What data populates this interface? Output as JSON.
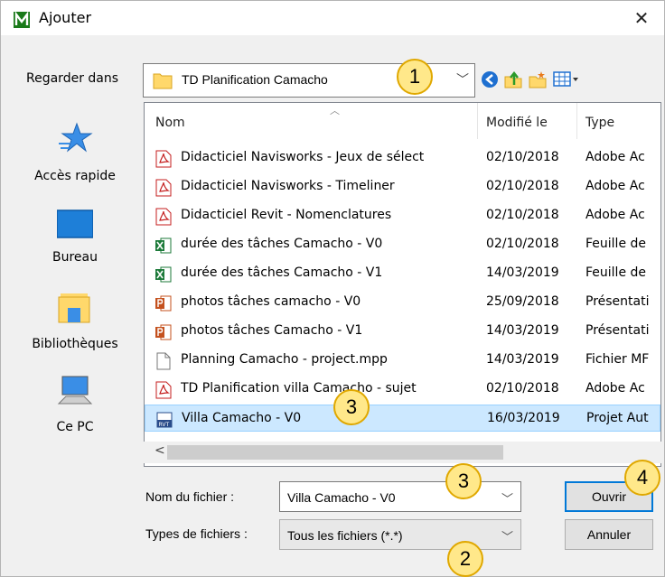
{
  "window": {
    "title": "Ajouter",
    "close_glyph": "✕"
  },
  "lookin": {
    "label": "Regarder dans",
    "value": "TD Planification Camacho"
  },
  "toolbar": {
    "icons": [
      "back-icon",
      "up-folder-icon",
      "new-folder-icon",
      "view-menu-icon"
    ]
  },
  "places": [
    {
      "label": "Accès rapide",
      "icon": "star-icon"
    },
    {
      "label": "Bureau",
      "icon": "desktop-icon"
    },
    {
      "label": "Bibliothèques",
      "icon": "library-icon"
    },
    {
      "label": "Ce PC",
      "icon": "computer-icon"
    }
  ],
  "columns": {
    "name": "Nom",
    "modified": "Modifié le",
    "type": "Type"
  },
  "files": [
    {
      "name": "Didacticiel Navisworks - Jeux de sélect",
      "date": "02/10/2018",
      "type": "Adobe Ac",
      "icon": "pdf"
    },
    {
      "name": "Didacticiel Navisworks - Timeliner",
      "date": "02/10/2018",
      "type": "Adobe Ac",
      "icon": "pdf"
    },
    {
      "name": "Didacticiel Revit - Nomenclatures",
      "date": "02/10/2018",
      "type": "Adobe Ac",
      "icon": "pdf"
    },
    {
      "name": "durée des tâches Camacho - V0",
      "date": "02/10/2018",
      "type": "Feuille de",
      "icon": "excel"
    },
    {
      "name": "durée des tâches Camacho - V1",
      "date": "14/03/2019",
      "type": "Feuille de",
      "icon": "excel"
    },
    {
      "name": "photos tâches camacho - V0",
      "date": "25/09/2018",
      "type": "Présentati",
      "icon": "ppt"
    },
    {
      "name": "photos tâches Camacho - V1",
      "date": "14/03/2019",
      "type": "Présentati",
      "icon": "ppt"
    },
    {
      "name": "Planning Camacho - project.mpp",
      "date": "14/03/2019",
      "type": "Fichier MF",
      "icon": "blank"
    },
    {
      "name": "TD Planification villa Camacho - sujet",
      "date": "02/10/2018",
      "type": "Adobe Ac",
      "icon": "pdf"
    },
    {
      "name": "Villa Camacho - V0",
      "date": "16/03/2019",
      "type": "Projet Aut",
      "icon": "rvt"
    }
  ],
  "filename": {
    "label": "Nom du fichier :",
    "value": "Villa Camacho - V0"
  },
  "filetype": {
    "label": "Types de fichiers :",
    "value": "Tous les fichiers (*.*)"
  },
  "buttons": {
    "open": "Ouvrir",
    "cancel": "Annuler"
  },
  "callouts": [
    "1",
    "3",
    "3",
    "2",
    "4"
  ],
  "colors": {
    "selection": "#cce8ff",
    "callout_fill": "#ffe88a",
    "callout_border": "#e0a800",
    "default_button_border": "#0078d7"
  }
}
